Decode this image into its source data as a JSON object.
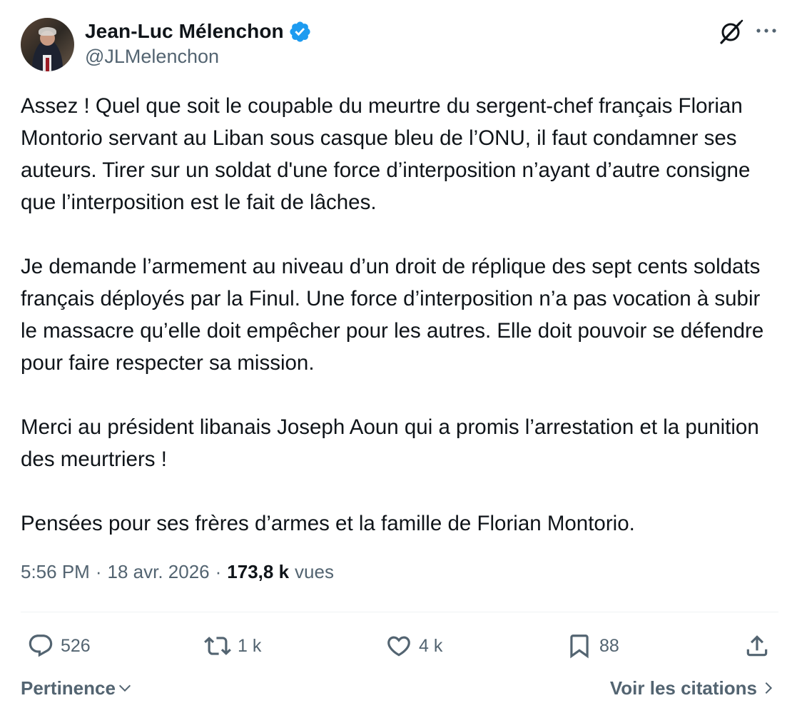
{
  "author": {
    "display_name": "Jean-Luc Mélenchon",
    "handle": "@JLMelenchon",
    "verified": true,
    "verified_color": "#1d9bf0"
  },
  "header_icons": [
    "grok-icon",
    "more-icon"
  ],
  "post": {
    "paragraphs": [
      "Assez ! Quel que soit le coupable du meurtre du sergent-chef français Florian Montorio servant au Liban sous casque bleu de l’ONU, il faut condamner ses auteurs. Tirer sur un soldat d'une force d’interposition n’ayant d’autre consigne que l’interposition est le fait de lâches.",
      "Je demande l’armement au niveau d’un droit de réplique des sept cents soldats français déployés par la Finul. Une force d’interposition n’a pas vocation à subir le massacre qu’elle doit empêcher pour les autres. Elle doit pouvoir se défendre pour faire respecter sa mission.",
      "Merci au président libanais Joseph Aoun qui a promis l’arrestation et la punition des meurtriers !",
      "Pensées pour ses frères d’armes et la famille de Florian Montorio."
    ],
    "time": "5:56 PM",
    "date": "18 avr. 2026",
    "separator": "·",
    "views_count": "173,8 k",
    "views_label": "vues"
  },
  "actions": {
    "replies": "526",
    "reposts": "1 k",
    "likes": "4 k",
    "bookmarks": "88"
  },
  "footer": {
    "sort_label": "Pertinence",
    "quotes_label": "Voir les citations"
  },
  "colors": {
    "text": "#0f1419",
    "secondary": "#536471",
    "divider": "#eff3f4",
    "verified": "#1d9bf0"
  }
}
